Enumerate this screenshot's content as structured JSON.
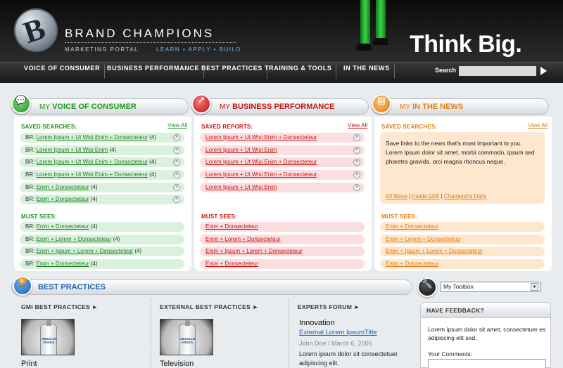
{
  "brand": {
    "name": "BRAND CHAMPIONS",
    "subtitle": "MARKETING PORTAL",
    "tagline_strip": "LEARN • APPLY • BUILD",
    "hero_tagline": "Think Big."
  },
  "nav": {
    "items": [
      "VOICE OF CONSUMER",
      "BUSINESS PERFORMANCE",
      "BEST PRACTICES",
      "TRAINING & TOOLS",
      "IN THE NEWS"
    ],
    "search_label": "Search",
    "search_value": ""
  },
  "panels": {
    "voc": {
      "my": "MY",
      "title": "VOICE OF CONSUMER",
      "saved_label": "SAVED SEARCHES:",
      "view_all": "View All",
      "saved": [
        {
          "prefix": "BR:",
          "link": "Lorem Ipsum + Ut Wisi Enim + Donsecteteur",
          "count": "(4)"
        },
        {
          "prefix": "BR:",
          "link": "Lorem Ipsum + Ut Wisi Enim",
          "count": "(4)"
        },
        {
          "prefix": "BR:",
          "link": "Lorem Ipsum + Ut Wisi Enim + Donsecteteur",
          "count": "(4)"
        },
        {
          "prefix": "BR:",
          "link": "Lorem Ipsum + Ut Wisi Enim + Donsecteteur",
          "count": "(4)"
        },
        {
          "prefix": "BR:",
          "link": "Enim + Donsecteteur",
          "count": "(4)"
        },
        {
          "prefix": "BR:",
          "link": "Enim + Donsecteteur",
          "count": "(4)"
        }
      ],
      "must_label": "MUST SEES:",
      "must": [
        {
          "prefix": "BR:",
          "link": "Enim + Donsecteteur",
          "count": "(4)"
        },
        {
          "prefix": "BR:",
          "link": "Enim + Lorem + Donsecteteur",
          "count": "(4)"
        },
        {
          "prefix": "BR:",
          "link": "Enim + Ipsum + Lorem + Donsecteteur",
          "count": "(4)"
        },
        {
          "prefix": "BR:",
          "link": "Enim + Donsecteteur",
          "count": "(4)"
        }
      ]
    },
    "bp": {
      "my": "MY",
      "title": "BUSINESS PERFORMANCE",
      "saved_label": "SAVED REPORTS:",
      "view_all": "View All",
      "saved": [
        "Lorem Ipsum + Ut Wisi Enim + Donsecteteur",
        "Lorem Ipsum + Ut Wisi Enim",
        "Lorem Ipsum + Ut Wisi Enim + Donsecteteur",
        "Lorem Ipsum + Ut Wisi Enim + Donsecteteur",
        "Lorem Ipsum + Ut Wisi Enim"
      ],
      "must_label": "MUST SEES:",
      "must": [
        "Enim + Donsecteteur",
        "Enim + Lorem + Donsecteteur",
        "Enim + Ipsum + Lorem + Donsecteteur",
        "Enim + Donsecteteur"
      ]
    },
    "news": {
      "my": "MY",
      "title": "IN THE NEWS",
      "saved_label": "SAVED SEARCHES:",
      "view_all": "View All",
      "box_text": "Save links to the news that's most important to you. Lorem ipsum dolor sit amet. morbi commodo, ipsum sed pharetra gravida, orci magna rhoncus neque.",
      "links": [
        "All News",
        "Inside GMI",
        "Champions Daily"
      ],
      "sep": "|",
      "must_label": "MUST SEES:",
      "must": [
        "Enim + Donsecteteur",
        "Enim + Lorem + Donsecteteur",
        "Enim + Ipsum + Lorem + Donsecteteur",
        "Enim + Donsecteteur"
      ]
    }
  },
  "best_practices": {
    "title": "BEST PRACTICES",
    "gmi_head": "GMI BEST PRACTICES ►",
    "gmi_caption": "Print",
    "ext_head": "EXTERNAL BEST PRACTICES ►",
    "ext_caption": "Television",
    "bottle_label": "ABSOLUT VODKA",
    "forum_head": "EXPERTS FORUM ►",
    "forum_title": "Innovation",
    "forum_link": "External Lorem IpsumTitle",
    "forum_meta": "John Doe / March 6, 2006",
    "forum_text": "Lorem ipsum dolor sit consectetuer adipiscing elit."
  },
  "toolbox": {
    "select_value": "My Toolbox"
  },
  "feedback": {
    "title": "HAVE FEEDBACK?",
    "text": "Lorem ipsum dolor sit amet, consectetuer es adipiscing elit sed.",
    "comments_label": "Your Comments:"
  },
  "colors": {
    "green": "#1f9a1f",
    "red": "#c51313",
    "orange": "#e67d12",
    "blue": "#1a5fb4"
  }
}
